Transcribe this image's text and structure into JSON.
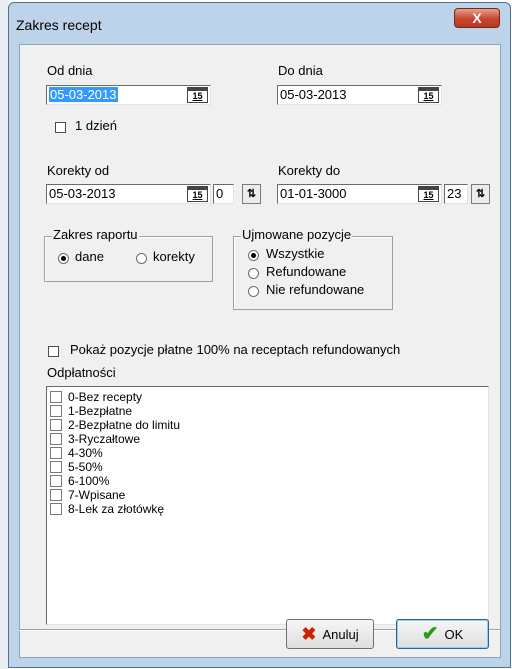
{
  "window": {
    "title": "Zakres recept",
    "close_label": "X"
  },
  "dates": {
    "od_label": "Od dnia",
    "od_value": "05-03-2013",
    "do_label": "Do dnia",
    "do_value": "05-03-2013",
    "cal_icon_label": "15",
    "one_day_label": "1 dzień",
    "one_day_checked": false
  },
  "corrections": {
    "od_label": "Korekty od",
    "od_value": "05-03-2013",
    "od_num": "0",
    "do_label": "Korekty do",
    "do_value": "01-01-3000",
    "do_num": "23"
  },
  "report_scope": {
    "title": "Zakres raportu",
    "options": [
      "dane",
      "korekty"
    ],
    "selected": "dane"
  },
  "positions": {
    "title": "Ujmowane pozycje",
    "options": [
      "Wszystkie",
      "Refundowane",
      "Nie refundowane"
    ],
    "selected": "Wszystkie"
  },
  "show_paid_label": "Pokaż pozycje płatne 100% na receptach refundowanych",
  "odplatnosci": {
    "label": "Odpłatności",
    "items": [
      "0-Bez recepty",
      "1-Bezpłatne",
      "2-Bezpłatne do limitu",
      "3-Ryczałtowe",
      "4-30%",
      "5-50%",
      "6-100%",
      "7-Wpisane",
      "8-Lek za złotówkę"
    ]
  },
  "buttons": {
    "cancel": "Anuluj",
    "ok": "OK"
  }
}
